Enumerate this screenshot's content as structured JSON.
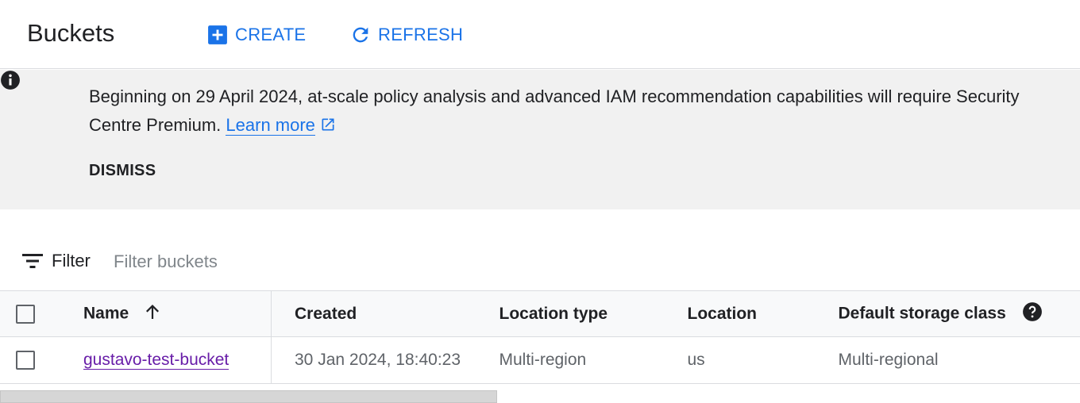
{
  "header": {
    "title": "Buckets",
    "create_label": "CREATE",
    "refresh_label": "REFRESH"
  },
  "banner": {
    "message": "Beginning on 29 April 2024, at-scale policy analysis and advanced IAM recommendation capabilities will require Security",
    "message_line2": "Centre Premium.",
    "learn_more": "Learn more",
    "dismiss": "DISMISS",
    "icon": "info-icon"
  },
  "filter": {
    "label": "Filter",
    "placeholder": "Filter buckets",
    "value": ""
  },
  "table": {
    "columns": [
      "Name",
      "Created",
      "Location type",
      "Location",
      "Default storage class"
    ],
    "sort_column": "Name",
    "sort_direction": "ascending",
    "rows": [
      {
        "name": "gustavo-test-bucket",
        "created": "30 Jan 2024, 18:40:23",
        "location_type": "Multi-region",
        "location": "us",
        "storage_class": "Multi-regional"
      }
    ]
  },
  "colors": {
    "accent": "#1a73e8",
    "visited_link": "#681da8",
    "banner_bg": "#f1f1f1"
  }
}
